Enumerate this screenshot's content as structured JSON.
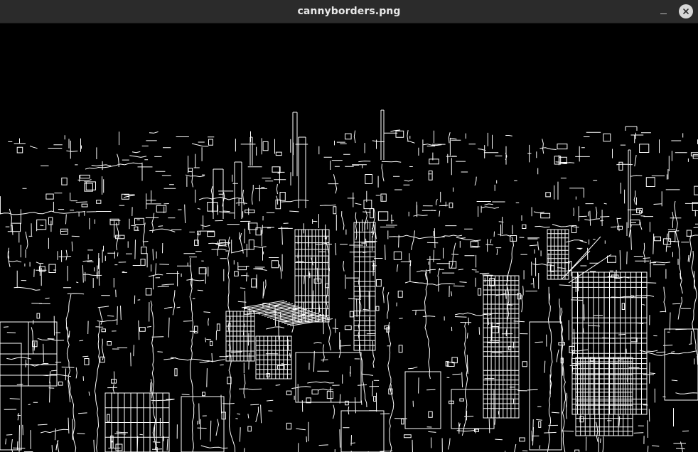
{
  "window": {
    "title": "cannyborders.png"
  },
  "controls": {
    "minimize_icon": "minimize-icon",
    "close_icon": "close-icon"
  },
  "image": {
    "description_icon": "edge-image",
    "background_color": "#000000",
    "edge_color": "#ffffff"
  }
}
